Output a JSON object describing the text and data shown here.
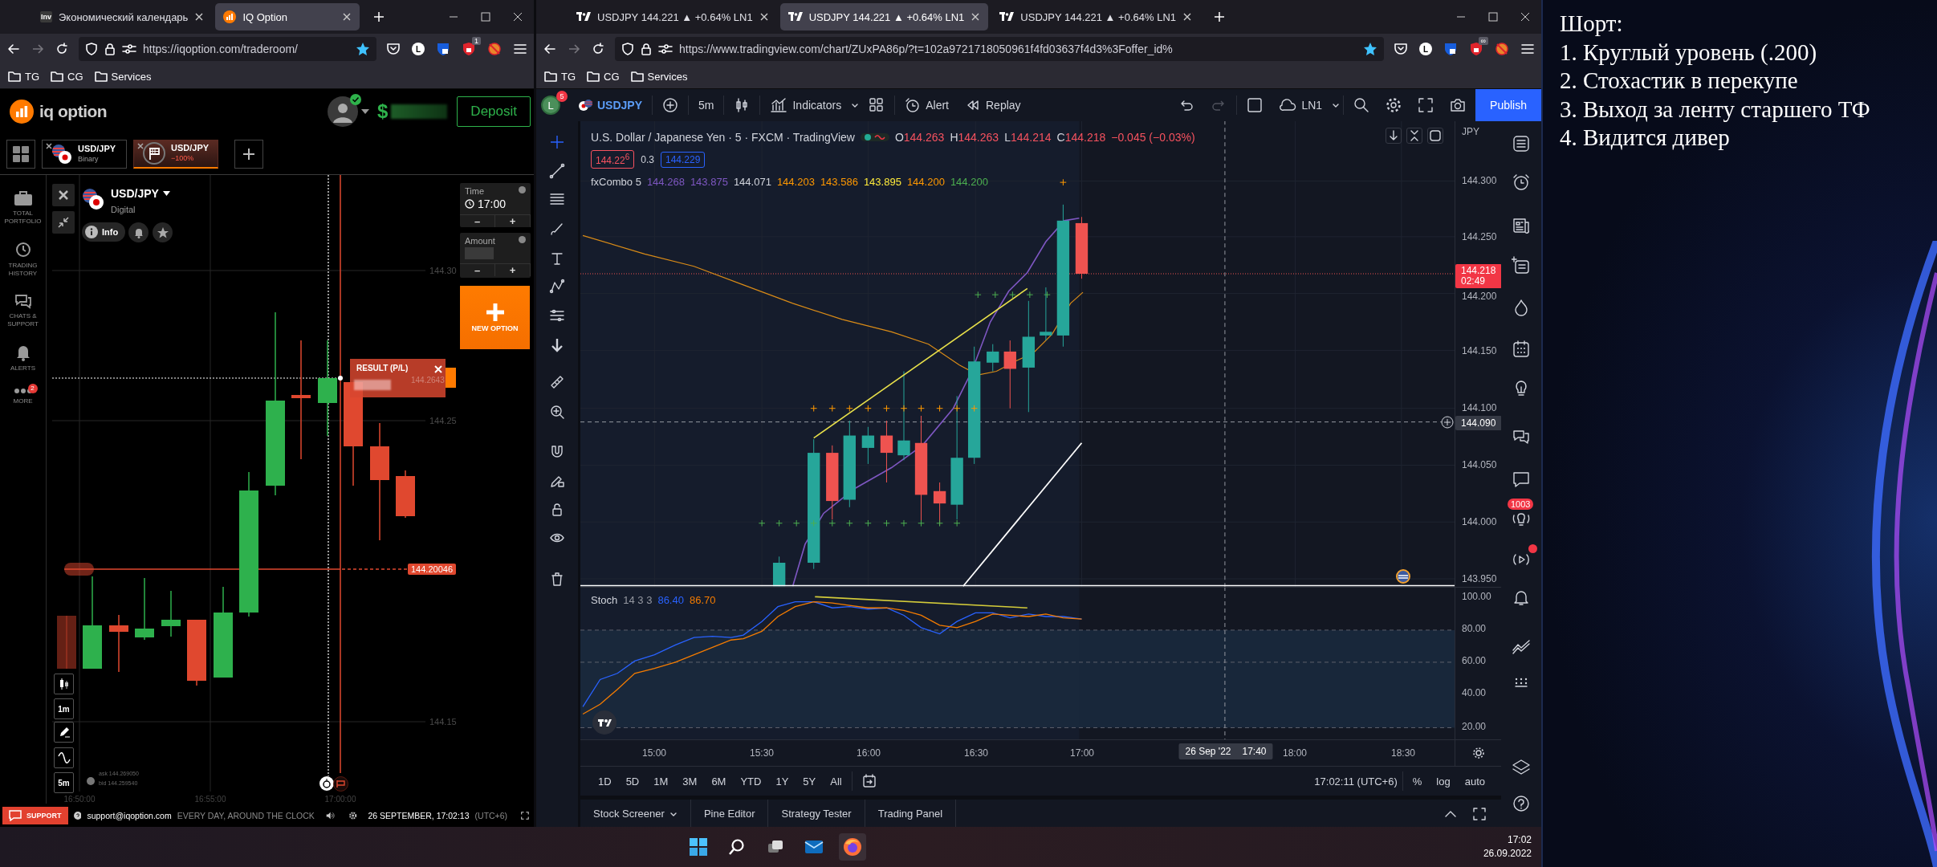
{
  "iq_window": {
    "tabs": [
      {
        "label": "Экономический календарь",
        "kind": "text-favicon",
        "icon_text": "Inv",
        "selected": false
      },
      {
        "label": "IQ Option",
        "kind": "circle-favicon",
        "selected": true
      }
    ],
    "url": "https://iqoption.com/traderoom/",
    "profile_letter": "L",
    "extension_badge": "1",
    "bookmarks": [
      "TG",
      "CG",
      "Services"
    ]
  },
  "iq_app": {
    "logo": "iq option",
    "balance_currency": "$",
    "deposit": "Deposit",
    "asset_tabs": [
      {
        "kind": "binary",
        "name": "USD/JPY",
        "subtitle": "Binary",
        "selected": false
      },
      {
        "kind": "closed",
        "name": "USD/JPY",
        "subtitle": "−100%",
        "selected": true
      }
    ],
    "sidebar": [
      {
        "label": "TOTAL PORTFOLIO"
      },
      {
        "label": "TRADING HISTORY"
      },
      {
        "label": "CHATS & SUPPORT"
      },
      {
        "label": "ALERTS"
      },
      {
        "label": "MORE",
        "badge": "2"
      }
    ],
    "asset": {
      "name": "USD/JPY",
      "type": "Digital",
      "info": "Info"
    },
    "time": {
      "label": "Time",
      "value": "17:00",
      "minus": "–",
      "plus": "+"
    },
    "amount": {
      "label": "Amount",
      "minus": "–",
      "plus": "+"
    },
    "new_option": "NEW OPTION",
    "chart": {
      "price_labels": [
        "144.30",
        "144.25",
        "144.15"
      ],
      "strike_price": "144.20046",
      "result_title": "RESULT (P/L)",
      "result_price": "144.2643",
      "times": [
        "16:50:00",
        "16:55:00",
        "17:00:00"
      ],
      "ask": "ask 144.269050",
      "bid": "bid 144.259540",
      "timeframes": [
        "1m",
        "5m"
      ]
    },
    "footer": {
      "support": "SUPPORT",
      "email": "support@iqoption.com",
      "hours": "EVERY DAY, AROUND THE CLOCK",
      "datetime": "26 SEPTEMBER, 17:02:13",
      "timezone": "(UTC+6)"
    }
  },
  "tv_window": {
    "tabs": [
      {
        "label": "USDJPY 144.221 ▲ +0.64% LN1",
        "kind": "tv-favicon",
        "selected": false
      },
      {
        "label": "USDJPY 144.221 ▲ +0.64% LN1",
        "kind": "tv-favicon",
        "selected": true
      },
      {
        "label": "USDJPY 144.221 ▲ +0.64% LN1",
        "kind": "tv-favicon",
        "selected": false
      }
    ],
    "url": "https://www.tradingview.com/chart/ZUxPA86p/?t=102a9721718050961f4fd03637f4d3%3Foffer_id%",
    "profile_letter": "L",
    "extension_badge": "∞",
    "bookmarks": [
      "TG",
      "CG",
      "Services"
    ]
  },
  "tv_app": {
    "toolbar": {
      "avatar": "L",
      "avatar_badge": "5",
      "symbol": "USDJPY",
      "interval": "5m",
      "indicators": "Indicators",
      "alert": "Alert",
      "replay": "Replay",
      "layout": "LN1",
      "publish": "Publish"
    },
    "legend": {
      "title": "U.S. Dollar / Japanese Yen · 5 · FXCM · TradingView",
      "ohlc": [
        {
          "label": "O",
          "value": "144.263"
        },
        {
          "label": "H",
          "value": "144.263"
        },
        {
          "label": "L",
          "value": "144.214"
        },
        {
          "label": "C",
          "value": "144.218"
        }
      ],
      "change": "−0.045 (−0.03%)",
      "bid": "144.22$^{6}$",
      "spread": "0.3",
      "ask": "144.229"
    },
    "indicator": {
      "name": "fxCombo 5",
      "values": [
        {
          "text": "144.268",
          "color": "#7e57c2"
        },
        {
          "text": "143.875",
          "color": "#7e57c2"
        },
        {
          "text": "144.071",
          "color": "#d1d4dc"
        },
        {
          "text": "144.203",
          "color": "#ff9800"
        },
        {
          "text": "143.586",
          "color": "#ff9800"
        },
        {
          "text": "143.895",
          "color": "#ffeb3b"
        },
        {
          "text": "144.200",
          "color": "#ff9800"
        },
        {
          "text": "144.200",
          "color": "#4caf50"
        }
      ]
    },
    "price_axis": {
      "currency": "JPY",
      "ticks": [
        "144.300",
        "144.250",
        "144.200",
        "144.150",
        "144.100",
        "144.050",
        "144.000",
        "143.950"
      ],
      "last_price": "144.218",
      "countdown": "02:49",
      "crosshair_price": "144.090"
    },
    "stoch": {
      "name": "Stoch",
      "params": "14 3 3",
      "values": [
        {
          "text": "86.40",
          "color": "#2962ff"
        },
        {
          "text": "86.70",
          "color": "#f57c00"
        }
      ],
      "ticks": [
        "100.00",
        "80.00",
        "60.00",
        "40.00",
        "20.00"
      ]
    },
    "time_axis": {
      "ticks": [
        "15:00",
        "15:30",
        "16:00",
        "16:30",
        "17:00",
        "18:00",
        "18:30"
      ],
      "crosshair_date": "26 Sep '22",
      "crosshair_time": "17:40"
    },
    "ranges": [
      "1D",
      "5D",
      "1M",
      "3M",
      "6M",
      "YTD",
      "1Y",
      "5Y",
      "All"
    ],
    "clock": "17:02:11 (UTC+6)",
    "scale_options": [
      "%",
      "log",
      "auto"
    ],
    "panel_tabs": [
      "Stock Screener",
      "Pine Editor",
      "Strategy Tester",
      "Trading Panel"
    ],
    "sidebar_badge": "1003"
  },
  "taskbar": {
    "time": "17:02",
    "date": "26.09.2022"
  },
  "notes": [
    "Шорт:",
    "1. Круглый уровень (.200)",
    "2. Стохастик в перекупе",
    "3. Выход за ленту старшего ТФ",
    "4. Видится дивер"
  ]
}
